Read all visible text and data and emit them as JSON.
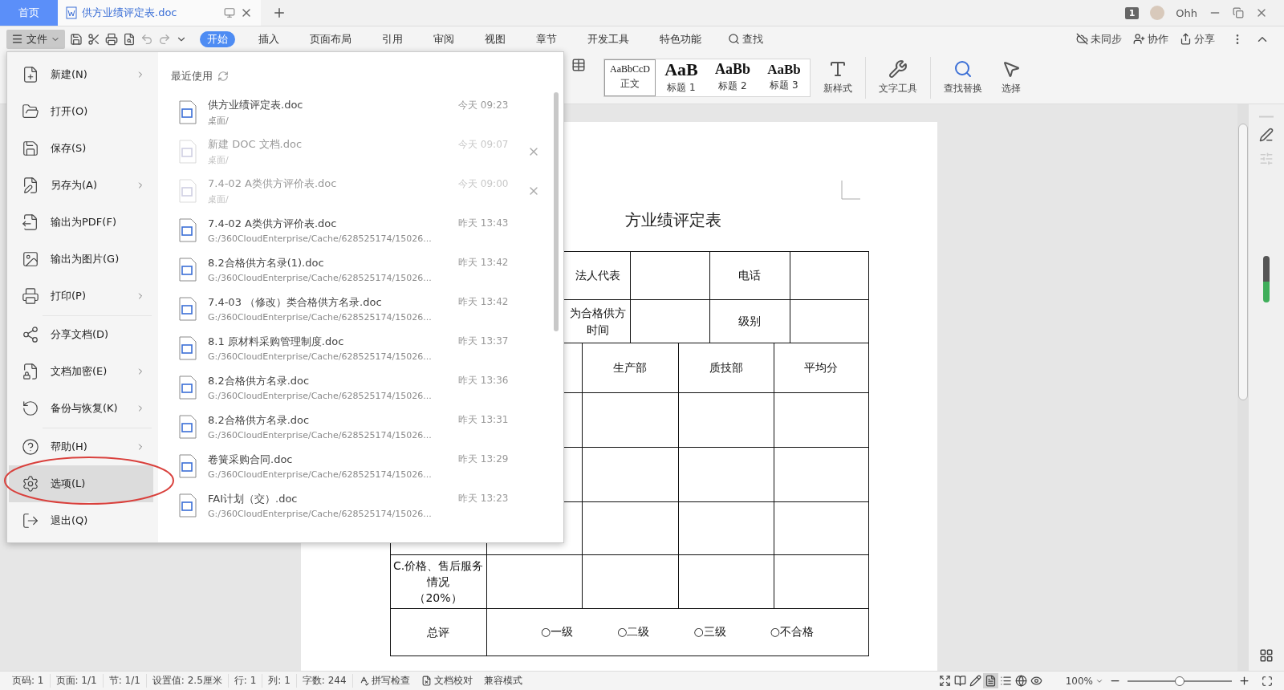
{
  "title_bar": {
    "tabs": [
      {
        "label": "首页",
        "kind": "home",
        "selected": false
      },
      {
        "label": "供方业绩评定表.doc",
        "kind": "document",
        "selected": true
      }
    ],
    "page_count": "1",
    "user": "Ohh"
  },
  "toolbar": {
    "file_label": "文件",
    "menu_open": true,
    "tabs": [
      {
        "label": "开始",
        "selected": true
      },
      {
        "label": "插入",
        "selected": false
      },
      {
        "label": "页面布局",
        "selected": false
      },
      {
        "label": "引用",
        "selected": false
      },
      {
        "label": "审阅",
        "selected": false
      },
      {
        "label": "视图",
        "selected": false
      },
      {
        "label": "章节",
        "selected": false
      },
      {
        "label": "开发工具",
        "selected": false
      },
      {
        "label": "特色功能",
        "selected": false
      }
    ],
    "search": "查找",
    "actions": [
      "未同步",
      "协作",
      "分享"
    ]
  },
  "ribbon": {
    "styles": [
      {
        "sample": "AaBbCcD",
        "label": "正文",
        "selected": true
      },
      {
        "sample": "AaB",
        "label": "标题 1",
        "selected": false
      },
      {
        "sample": "AaBb",
        "label": "标题 2",
        "selected": false
      },
      {
        "sample": "AaBb",
        "label": "标题 3",
        "selected": false
      }
    ],
    "tools": [
      "新样式",
      "文字工具",
      "查找替换",
      "选择"
    ]
  },
  "file_menu": {
    "groups": [
      [
        {
          "label": "新建(N)",
          "submenu": true,
          "selected": false
        },
        {
          "label": "打开(O)",
          "submenu": false,
          "selected": false
        },
        {
          "label": "保存(S)",
          "submenu": false,
          "selected": false
        },
        {
          "label": "另存为(A)",
          "submenu": true,
          "selected": false
        },
        {
          "label": "输出为PDF(F)",
          "submenu": false,
          "selected": false
        },
        {
          "label": "输出为图片(G)",
          "submenu": false,
          "selected": false
        },
        {
          "label": "打印(P)",
          "submenu": true,
          "selected": false
        }
      ],
      [
        {
          "label": "分享文档(D)",
          "submenu": false,
          "selected": false
        },
        {
          "label": "文档加密(E)",
          "submenu": true,
          "selected": false
        },
        {
          "label": "备份与恢复(K)",
          "submenu": true,
          "selected": false
        }
      ],
      [
        {
          "label": "帮助(H)",
          "submenu": true,
          "selected": false
        },
        {
          "label": "选项(L)",
          "submenu": false,
          "selected": true
        },
        {
          "label": "退出(Q)",
          "submenu": false,
          "selected": false
        }
      ]
    ],
    "recent_title": "最近使用",
    "recent": [
      {
        "name": "供方业绩评定表.doc",
        "path": "桌面/",
        "time": "今天 09:23",
        "missing": false
      },
      {
        "name": "新建 DOC 文档.doc",
        "path": "桌面/",
        "time": "今天 09:07",
        "missing": true
      },
      {
        "name": "7.4-02  A类供方评价表.doc",
        "path": "桌面/",
        "time": "今天 09:00",
        "missing": true
      },
      {
        "name": "7.4-02  A类供方评价表.doc",
        "path": "G:/360CloudEnterprise/Cache/628525174/15026...",
        "time": "昨天 13:43",
        "missing": false
      },
      {
        "name": "8.2合格供方名录(1).doc",
        "path": "G:/360CloudEnterprise/Cache/628525174/15026...",
        "time": "昨天 13:42",
        "missing": false
      },
      {
        "name": "7.4-03 （修改）类合格供方名录.doc",
        "path": "G:/360CloudEnterprise/Cache/628525174/15026...",
        "time": "昨天 13:42",
        "missing": false
      },
      {
        "name": "8.1 原材料采购管理制度.doc",
        "path": "G:/360CloudEnterprise/Cache/628525174/15026...",
        "time": "昨天 13:37",
        "missing": false
      },
      {
        "name": "8.2合格供方名录.doc",
        "path": "G:/360CloudEnterprise/Cache/628525174/15026...",
        "time": "昨天 13:36",
        "missing": false
      },
      {
        "name": "8.2合格供方名录.doc",
        "path": "G:/360CloudEnterprise/Cache/628525174/15026...",
        "time": "昨天 13:31",
        "missing": false
      },
      {
        "name": "卷簧采购合同.doc",
        "path": "G:/360CloudEnterprise/Cache/628525174/15026...",
        "time": "昨天 13:29",
        "missing": false
      },
      {
        "name": "FAI计划（交）.doc",
        "path": "G:/360CloudEnterprise/Cache/628525174/15026...",
        "time": "昨天 13:23",
        "missing": false
      }
    ]
  },
  "document": {
    "title": "方业绩评定表",
    "table": {
      "rows": [
        {
          "kind": "info",
          "cells": [
            null,
            "法人代表",
            null,
            "电话",
            null
          ]
        },
        {
          "kind": "info",
          "cells": [
            null,
            [
              "为合格供方",
              "时间"
            ],
            null,
            "级别",
            null
          ]
        },
        {
          "kind": "grid",
          "cells": [
            null,
            null,
            "生产部",
            "质技部",
            "平均分"
          ]
        },
        {
          "kind": "grid",
          "cells": [
            null,
            null,
            null,
            null,
            null
          ]
        },
        {
          "kind": "grid",
          "cells": [
            null,
            null,
            null,
            null,
            null
          ]
        },
        {
          "kind": "grid",
          "cells": [
            null,
            null,
            null,
            null,
            null
          ]
        },
        {
          "kind": "grid",
          "cells": [
            [
              "C.价格、售后服务",
              "情况",
              "（20%）"
            ],
            null,
            null,
            null,
            null
          ]
        },
        {
          "kind": "total",
          "label": "总评",
          "options": [
            "○一级",
            "○二级",
            "○三级",
            "○不合格"
          ]
        }
      ]
    }
  },
  "status_bar": {
    "fields": [
      "页码: 1",
      "页面: 1/1",
      "节: 1/1",
      "设置值: 2.5厘米",
      "行: 1",
      "列: 1",
      "字数: 244"
    ],
    "checks": [
      "拼写检查",
      "文档校对"
    ],
    "mode": "兼容模式",
    "zoom": "100%",
    "zoom_slider": {
      "level": 0.5
    }
  }
}
